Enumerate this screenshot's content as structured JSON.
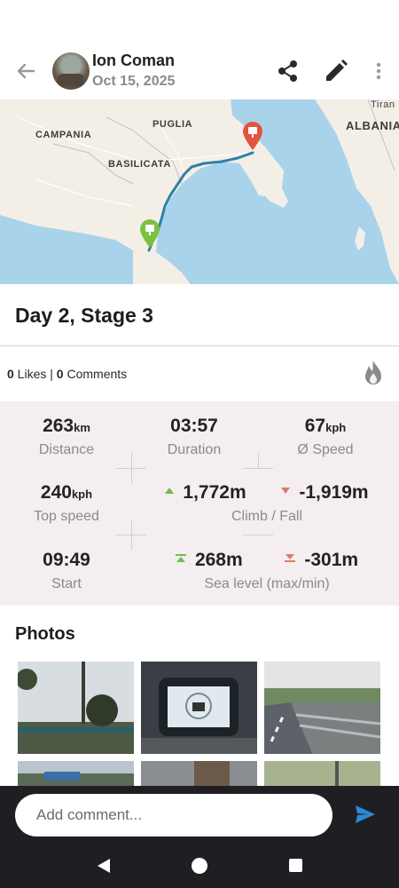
{
  "header": {
    "user_name": "Ion Coman",
    "date": "Oct 15, 2025",
    "icons": [
      "back-arrow-icon",
      "share-icon",
      "edit-pencil-icon",
      "more-vertical-icon"
    ]
  },
  "map": {
    "labels": {
      "puglia": "PUGLIA",
      "campania": "CAMPANIA",
      "basilicata": "BASILICATA",
      "albania": "ALBANIA",
      "tirana": "Tiran"
    },
    "route_color": "#2f80a6",
    "start_marker_color": "#7cc242",
    "end_marker_color": "#e2543e"
  },
  "activity": {
    "title": "Day 2, Stage 3"
  },
  "social": {
    "likes_count": "0",
    "likes_label": " Likes | ",
    "comments_count": "0",
    "comments_label": " Comments"
  },
  "stats": {
    "distance": {
      "value": "263",
      "unit": "km",
      "label": "Distance"
    },
    "duration": {
      "value": "03:57",
      "label": "Duration"
    },
    "avg_speed": {
      "value": "67",
      "unit": "kph",
      "label": "Ø Speed"
    },
    "top_speed": {
      "value": "240",
      "unit": "kph",
      "label": "Top speed"
    },
    "climb": {
      "value": "1,772m"
    },
    "fall": {
      "value": "-1,919m"
    },
    "climb_fall_label": "Climb / Fall",
    "start": {
      "value": "09:49",
      "label": "Start"
    },
    "sea_max": {
      "value": "268m"
    },
    "sea_min": {
      "value": "-301m"
    },
    "sea_level_label": "Sea level (max/min)",
    "climb_color": "#6cc04a",
    "fall_color": "#e07a6b"
  },
  "photos": {
    "title": "Photos",
    "items": [
      "roadside-trees",
      "motorcycle-dashboard",
      "highway-guardrail",
      "parking-lot",
      "road-scene",
      "vegetation"
    ]
  },
  "comment": {
    "placeholder": "Add comment..."
  },
  "colors": {
    "accent": "#2a8ad6",
    "stats_background": "#f4eef0",
    "bottom_bar": "#1f1f23"
  }
}
